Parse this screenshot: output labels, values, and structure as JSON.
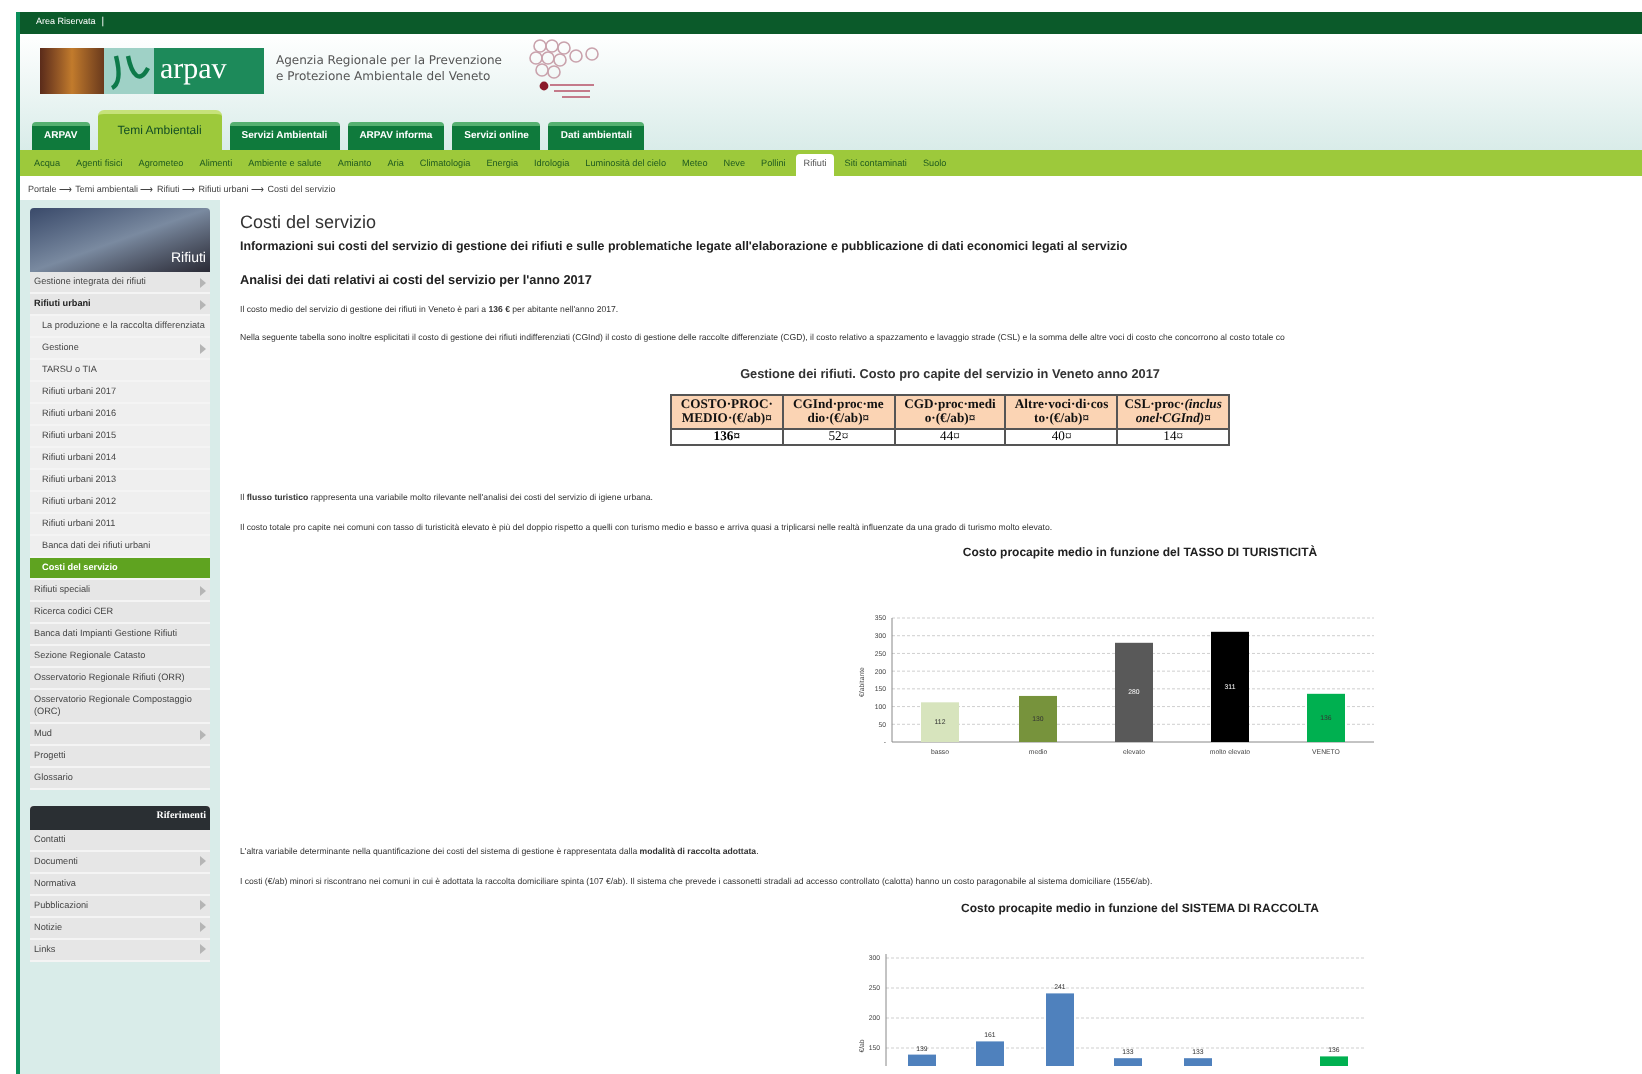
{
  "top_bar": {
    "link": "Area Riservata",
    "separator": "|"
  },
  "header": {
    "logo_text": "arpav",
    "agency_lines": [
      "Agenzia Regionale per la Prevenzione",
      "e Protezione Ambientale del Veneto"
    ]
  },
  "tabs": [
    {
      "label": "ARPAV",
      "selected": false
    },
    {
      "label": "Temi Ambientali",
      "selected": true
    },
    {
      "label": "Servizi Ambientali",
      "selected": false
    },
    {
      "label": "ARPAV informa",
      "selected": false
    },
    {
      "label": "Servizi online",
      "selected": false
    },
    {
      "label": "Dati ambientali",
      "selected": false
    }
  ],
  "topics": [
    {
      "label": "Acqua",
      "selected": false
    },
    {
      "label": "Agenti fisici",
      "selected": false
    },
    {
      "label": "Agrometeo",
      "selected": false
    },
    {
      "label": "Alimenti",
      "selected": false
    },
    {
      "label": "Ambiente e salute",
      "selected": false
    },
    {
      "label": "Amianto",
      "selected": false
    },
    {
      "label": "Aria",
      "selected": false
    },
    {
      "label": "Climatologia",
      "selected": false
    },
    {
      "label": "Energia",
      "selected": false
    },
    {
      "label": "Idrologia",
      "selected": false
    },
    {
      "label": "Luminosità del cielo",
      "selected": false
    },
    {
      "label": "Meteo",
      "selected": false
    },
    {
      "label": "Neve",
      "selected": false
    },
    {
      "label": "Pollini",
      "selected": false
    },
    {
      "label": "Rifiuti",
      "selected": true
    },
    {
      "label": "Siti contaminati",
      "selected": false
    },
    {
      "label": "Suolo",
      "selected": false
    }
  ],
  "breadcrumb": "Portale ⟶ Temi ambientali ⟶ Rifiuti ⟶ Rifiuti urbani ⟶ Costi del servizio",
  "sidebar": {
    "banner_title": "Rifiuti",
    "items": [
      {
        "label": "Gestione integrata dei rifiuti",
        "submenu": true,
        "selected": false
      },
      {
        "label": "Rifiuti urbani",
        "submenu": true,
        "selected": false,
        "expanded": true,
        "children": [
          {
            "label": "La produzione e la raccolta differenziata",
            "submenu": false,
            "selected": false
          },
          {
            "label": "Gestione",
            "submenu": true,
            "selected": false
          },
          {
            "label": "TARSU o TIA",
            "submenu": false,
            "selected": false
          },
          {
            "label": "Rifiuti urbani 2017",
            "submenu": false,
            "selected": false
          },
          {
            "label": "Rifiuti urbani 2016",
            "submenu": false,
            "selected": false
          },
          {
            "label": "Rifiuti urbani 2015",
            "submenu": false,
            "selected": false
          },
          {
            "label": "Rifiuti urbani 2014",
            "submenu": false,
            "selected": false
          },
          {
            "label": "Rifiuti urbani 2013",
            "submenu": false,
            "selected": false
          },
          {
            "label": "Rifiuti urbani 2012",
            "submenu": false,
            "selected": false
          },
          {
            "label": "Rifiuti urbani 2011",
            "submenu": false,
            "selected": false
          },
          {
            "label": "Banca dati dei rifiuti urbani",
            "submenu": false,
            "selected": false
          },
          {
            "label": "Costi del servizio",
            "submenu": false,
            "selected": true
          }
        ]
      },
      {
        "label": "Rifiuti speciali",
        "submenu": true,
        "selected": false
      },
      {
        "label": "Ricerca codici CER",
        "submenu": false,
        "selected": false
      },
      {
        "label": "Banca dati Impianti Gestione Rifiuti",
        "submenu": false,
        "selected": false
      },
      {
        "label": "Sezione Regionale Catasto",
        "submenu": false,
        "selected": false
      },
      {
        "label": "Osservatorio Regionale Rifiuti (ORR)",
        "submenu": false,
        "selected": false
      },
      {
        "label": "Osservatorio Regionale Compostaggio (ORC)",
        "submenu": false,
        "selected": false
      },
      {
        "label": "Mud",
        "submenu": true,
        "selected": false
      },
      {
        "label": "Progetti",
        "submenu": false,
        "selected": false
      },
      {
        "label": "Glossario",
        "submenu": false,
        "selected": false
      }
    ],
    "references": {
      "title": "Riferimenti",
      "items": [
        {
          "label": "Contatti",
          "submenu": false
        },
        {
          "label": "Documenti",
          "submenu": true
        },
        {
          "label": "Normativa",
          "submenu": false
        },
        {
          "label": "Pubblicazioni",
          "submenu": true
        },
        {
          "label": "Notizie",
          "submenu": true
        },
        {
          "label": "Links",
          "submenu": true
        }
      ]
    }
  },
  "content": {
    "title": "Costi del servizio",
    "subtitle": "Informazioni sui costi del servizio di gestione dei rifiuti e sulle problematiche legate all'elaborazione e pubblicazione di dati economici legati al servizio",
    "section_title": "Analisi dei dati relativi ai costi del servizio per l'anno 2017",
    "paragraphs_1": [
      "Il costo medio del servizio di gestione dei rifiuti in Veneto è pari a **136 €** per abitante nell'anno 2017.",
      "Nella seguente tabella sono inoltre esplicitati il costo di gestione dei rifiuti indifferenziati (CGInd) il costo di gestione delle raccolte differenziate (CGD), il costo relativo a spazzamento e lavaggio strade (CSL) e la somma delle altre voci di costo che concorrono al costo totale co"
    ],
    "table": {
      "title": "Gestione dei rifiuti. Costo pro capite del servizio in Veneto anno 2017",
      "columns": [
        "COSTO·PROC·MEDIO·(€/ab)¤",
        "CGInd·proc·medio·(€/ab)¤",
        "CGD·proc·medio·(€/ab)¤",
        "Altre·voci·di·costo·(€/ab)¤",
        "CSL·proc·*(inclusonel·CGInd)*¤"
      ],
      "rows": [
        [
          "136¤",
          "52¤",
          "44¤",
          "40¤",
          "14¤"
        ]
      ]
    },
    "paragraphs_2": [
      "Il **flusso turistico** rappresenta una variabile molto rilevante nell'analisi dei costi del servizio di igiene urbana.",
      "Il costo totale pro capite nei comuni con tasso di turisticità elevato è più del doppio rispetto a quelli con turismo medio e basso e arriva quasi a triplicarsi nelle realtà influenzate da una grado di turismo molto elevato."
    ],
    "chart_1": {
      "chart_data": {
        "type": "bar",
        "title": "Costo procapite medio in funzione del TASSO DI TURISTICITÀ",
        "ylabel": "€/abitante",
        "categories": [
          "basso",
          "medio",
          "elevato",
          "molto elevato",
          "VENETO"
        ],
        "series": [
          {
            "values": [
              112,
              130,
              280,
              311,
              136
            ]
          }
        ],
        "grid": true,
        "colors": [
          "#d7e4bd",
          "#77933c",
          "#595959",
          "#000000",
          "#00b050"
        ],
        "ylim": [
          0,
          350
        ],
        "yticks": [
          {
            "value": 0,
            "label": "-"
          },
          50,
          100,
          150,
          200,
          250,
          300,
          350
        ],
        "data_labels": true
      }
    },
    "paragraphs_3": [
      "L'altra variabile determinante nella quantificazione dei costi del sistema di gestione è rappresentata dalla **modalità di raccolta adottata**.",
      "I costi (€/ab) minori si riscontrano nei comuni in cui è adottata la raccolta domiciliare spinta (107 €/ab). Il sistema che prevede i cassonetti stradali ad accesso controllato (calotta) hanno un costo paragonabile al sistema domiciliare (155€/ab)."
    ],
    "chart_2": {
      "chart_data": {
        "type": "bar",
        "title": "Costo procapite medio in funzione del SISTEMA DI RACCOLTA",
        "ylabel": "€/ab",
        "series": [
          {
            "values": [
              139,
              161,
              241,
              133,
              133,
              null,
              136
            ]
          }
        ],
        "grid": true,
        "ylim": [
          120,
          300
        ],
        "colors": [
          "#4f81bd",
          "#4f81bd",
          "#4f81bd",
          "#4f81bd",
          "#4f81bd",
          "#4f81bd",
          "#00b050"
        ],
        "yticks": [
          150,
          200,
          250,
          300
        ],
        "data_labels": true
      }
    }
  }
}
